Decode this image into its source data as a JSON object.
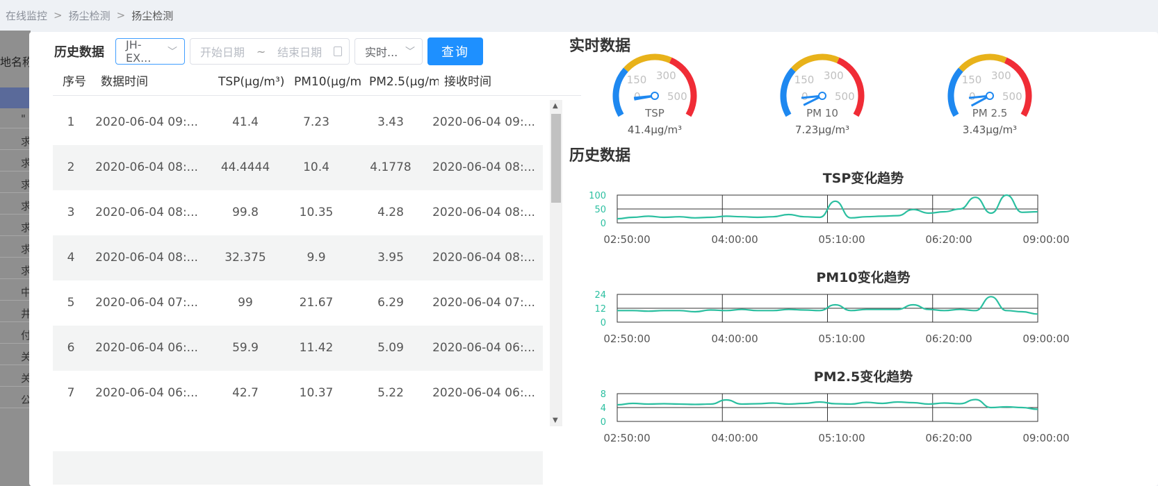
{
  "breadcrumb": [
    "在线监控",
    "扬尘检测",
    "扬尘检测"
  ],
  "background": {
    "title_fragment": "地名称",
    "row_glyphs": [
      "\"",
      "求",
      "求",
      "求",
      "求",
      "求",
      "求",
      "求",
      "中",
      "井",
      "付",
      "关",
      "关",
      "公"
    ]
  },
  "history_panel": {
    "title": "历史数据",
    "device_select": "JH-EX...",
    "date_start_placeholder": "开始日期",
    "date_sep": "~",
    "date_end_placeholder": "结束日期",
    "mode_select": "实时...",
    "query_button": "查询",
    "columns": [
      "序号",
      "数据时间",
      "TSP(μg/m³)",
      "PM10(μg/m",
      "PM2.5(μg/m",
      "接收时间"
    ],
    "rows": [
      [
        "1",
        "2020-06-04 09:...",
        "41.4",
        "7.23",
        "3.43",
        "2020-06-04 09:..."
      ],
      [
        "2",
        "2020-06-04 08:...",
        "44.4444",
        "10.4",
        "4.1778",
        "2020-06-04 08:..."
      ],
      [
        "3",
        "2020-06-04 08:...",
        "99.8",
        "10.35",
        "4.28",
        "2020-06-04 08:..."
      ],
      [
        "4",
        "2020-06-04 08:...",
        "32.375",
        "9.9",
        "3.95",
        "2020-06-04 08:..."
      ],
      [
        "5",
        "2020-06-04 07:...",
        "99",
        "21.67",
        "6.29",
        "2020-06-04 07:..."
      ],
      [
        "6",
        "2020-06-04 06:...",
        "59.9",
        "11.42",
        "5.09",
        "2020-06-04 06:..."
      ],
      [
        "7",
        "2020-06-04 06:...",
        "42.7",
        "10.37",
        "5.22",
        "2020-06-04 06:..."
      ]
    ]
  },
  "realtime": {
    "title": "实时数据",
    "gauges": [
      {
        "name": "TSP",
        "value": 41.4,
        "display": "41.4μg/m³",
        "max": 500,
        "ticks": [
          "0",
          "150",
          "300",
          "500"
        ]
      },
      {
        "name": "PM 10",
        "value": 7.23,
        "display": "7.23μg/m³",
        "max": 500,
        "ticks": [
          "0",
          "150",
          "300",
          "500"
        ]
      },
      {
        "name": "PM 2.5",
        "value": 3.43,
        "display": "3.43μg/m³",
        "max": 500,
        "ticks": [
          "0",
          "150",
          "300",
          "500"
        ]
      }
    ],
    "colors": {
      "low": "#1e88f0",
      "mid": "#e8b21a",
      "high": "#f02c36",
      "needle": "#1e88f0"
    }
  },
  "history_charts_title": "历史数据",
  "chart_data": [
    {
      "type": "line",
      "title": "TSP变化趋势",
      "x_ticks": [
        "02:50:00",
        "04:00:00",
        "05:10:00",
        "06:20:00",
        "09:00:00"
      ],
      "y_ticks": [
        "0",
        "50",
        "100"
      ],
      "ylim": [
        0,
        100
      ],
      "color": "#2bbfa0",
      "grid": true,
      "values": [
        15,
        20,
        24,
        20,
        22,
        18,
        20,
        24,
        22,
        20,
        22,
        30,
        22,
        20,
        78,
        18,
        22,
        24,
        26,
        48,
        35,
        40,
        50,
        92,
        35,
        100,
        38,
        40
      ]
    },
    {
      "type": "line",
      "title": "PM10变化趋势",
      "x_ticks": [
        "02:50:00",
        "04:00:00",
        "05:10:00",
        "06:20:00",
        "09:00:00"
      ],
      "y_ticks": [
        "0",
        "12",
        "24"
      ],
      "ylim": [
        0,
        24
      ],
      "color": "#2bbfa0",
      "grid": true,
      "values": [
        10,
        10,
        9.5,
        10,
        10,
        9,
        10.5,
        10,
        11,
        10,
        10,
        11,
        10.5,
        10,
        15,
        10,
        11,
        11,
        11,
        15,
        11,
        10,
        11,
        10,
        22,
        10,
        9,
        7
      ]
    },
    {
      "type": "line",
      "title": "PM2.5变化趋势",
      "x_ticks": [
        "02:50:00",
        "04:00:00",
        "05:10:00",
        "06:20:00",
        "09:00:00"
      ],
      "y_ticks": [
        "0",
        "4",
        "8"
      ],
      "ylim": [
        0,
        8
      ],
      "color": "#2bbfa0",
      "grid": true,
      "values": [
        4.8,
        5.2,
        5.0,
        5.1,
        5.0,
        4.9,
        5.0,
        6.2,
        5.0,
        5.1,
        5.3,
        5.0,
        5.2,
        5.6,
        5.1,
        5.0,
        5.5,
        5.2,
        5.6,
        5.4,
        5.0,
        5.3,
        5.1,
        6.3,
        4.0,
        4.2,
        4.0,
        3.5
      ]
    }
  ]
}
